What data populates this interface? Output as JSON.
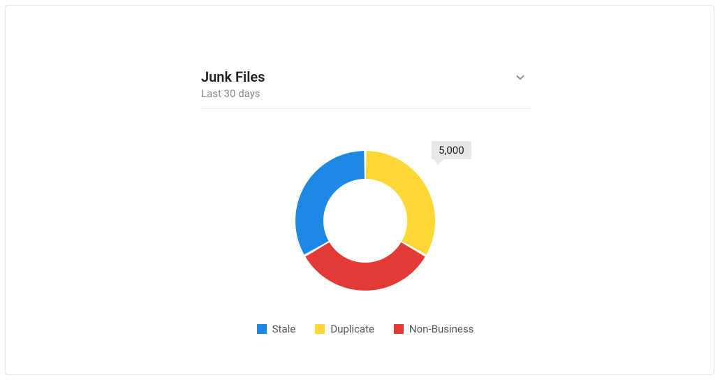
{
  "widget": {
    "title": "Junk Files",
    "subtitle": "Last 30 days",
    "tooltip_value": "5,000"
  },
  "legend": {
    "items": [
      {
        "label": "Stale",
        "color": "#1E88E5"
      },
      {
        "label": "Duplicate",
        "color": "#FDD835"
      },
      {
        "label": "Non-Business",
        "color": "#E53935"
      }
    ]
  },
  "chart_data": {
    "type": "pie",
    "title": "Junk Files",
    "subtitle": "Last 30 days",
    "series": [
      {
        "name": "Stale",
        "value": 5000,
        "color": "#1E88E5"
      },
      {
        "name": "Duplicate",
        "value": 5000,
        "color": "#FDD835"
      },
      {
        "name": "Non-Business",
        "value": 5000,
        "color": "#E53935"
      }
    ],
    "highlighted": {
      "name": "Duplicate",
      "display_value": "5,000"
    },
    "donut": true
  }
}
